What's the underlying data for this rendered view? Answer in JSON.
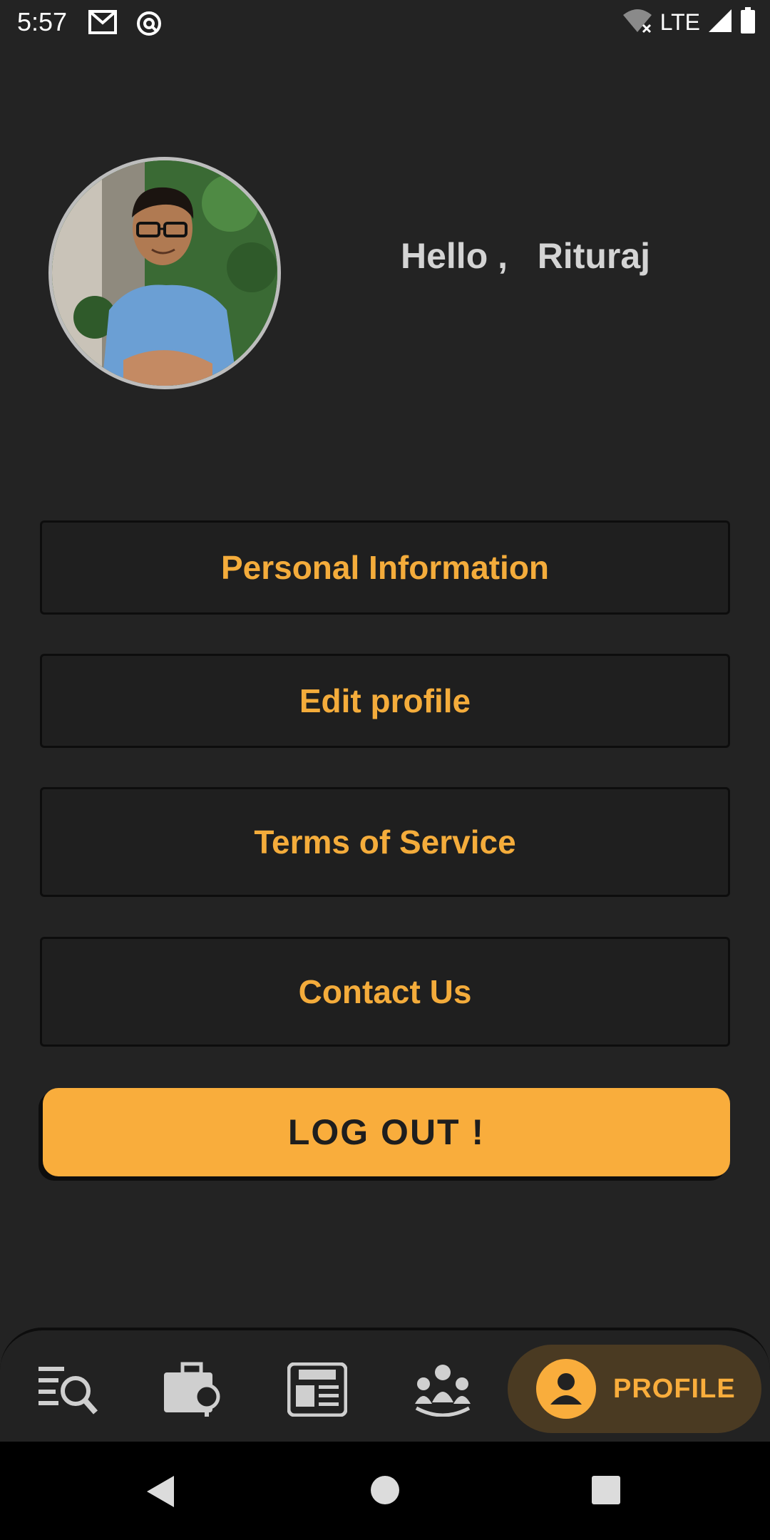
{
  "status_bar": {
    "time": "5:57",
    "network": "LTE",
    "icons": [
      "gmail-icon",
      "sync-icon",
      "wifi-off-icon",
      "signal-icon",
      "battery-icon"
    ]
  },
  "profile": {
    "greeting": "Hello ,   Rituraj",
    "avatar": "profile-photo"
  },
  "menu": {
    "personal_information": "Personal Information",
    "edit_profile": "Edit profile",
    "terms_of_service": "Terms of Service",
    "contact_us": "Contact Us",
    "logout": "LOG OUT !"
  },
  "bottom_nav": {
    "items": [
      {
        "icon": "search-list-icon"
      },
      {
        "icon": "briefcase-search-icon"
      },
      {
        "icon": "news-icon"
      },
      {
        "icon": "group-icon"
      },
      {
        "icon": "profile-icon",
        "label": "PROFILE",
        "active": true
      }
    ]
  },
  "colors": {
    "background": "#232323",
    "accent": "#f9ad3c",
    "button_bg": "#1f1f1f",
    "greeting_text": "#d4d4d4"
  }
}
